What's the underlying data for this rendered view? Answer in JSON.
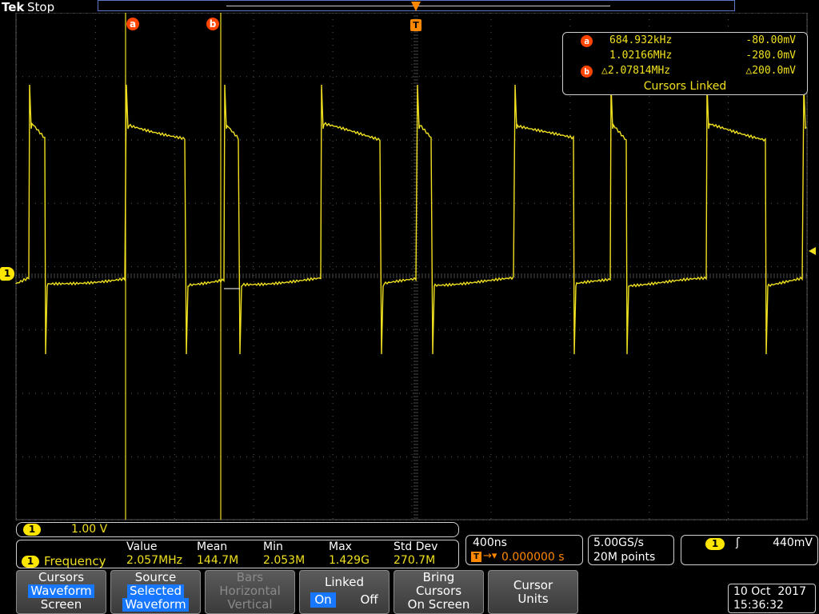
{
  "header": {
    "brand": "Tek",
    "state": "Stop"
  },
  "markers": {
    "cursor_a": "a",
    "cursor_b": "b",
    "trigger": "T",
    "channel": "1"
  },
  "cursor_readout": {
    "a_freq": "684.932kHz",
    "a_volt": "-80.00mV",
    "b_freq": "1.02166MHz",
    "b_volt": "-280.0mV",
    "delta_freq": "△2.07814MHz",
    "delta_volt": "△200.0mV",
    "linked": "Cursors Linked"
  },
  "channel_scale": {
    "channel": "1",
    "scale": "1.00 V"
  },
  "measurement": {
    "channel": "1",
    "name": "Frequency",
    "headers": [
      "Value",
      "Mean",
      "Min",
      "Max",
      "Std Dev"
    ],
    "values": [
      "2.057MHz",
      "144.7M",
      "2.053M",
      "1.429G",
      "270.7M"
    ]
  },
  "horizontal": {
    "timebase": "400ns",
    "position": "0.000000 s"
  },
  "acquisition": {
    "rate": "5.00GS/s",
    "points": "20M points"
  },
  "trigger": {
    "channel": "1",
    "level": "440mV"
  },
  "menu": {
    "cursors": {
      "title": "Cursors",
      "selected": "Waveform",
      "other": "Screen"
    },
    "source": {
      "title": "Source",
      "line1": "Selected",
      "line2": "Waveform"
    },
    "bars": {
      "title": "Bars",
      "line1": "Horizontal",
      "line2": "Vertical"
    },
    "linked": {
      "title": "Linked",
      "on": "On",
      "off": "Off"
    },
    "bring": {
      "line1": "Bring",
      "line2": "Cursors",
      "line3": "On Screen"
    },
    "units": {
      "line1": "Cursor",
      "line2": "Units"
    }
  },
  "datetime": {
    "date": "10 Oct  2017",
    "time": "15:36:32"
  },
  "colors": {
    "trace": "#f0e020",
    "cursor": "#f0e020",
    "trigger": "#ff8800",
    "badge_a": "#ff4500",
    "grid": "#4a4a4a"
  }
}
